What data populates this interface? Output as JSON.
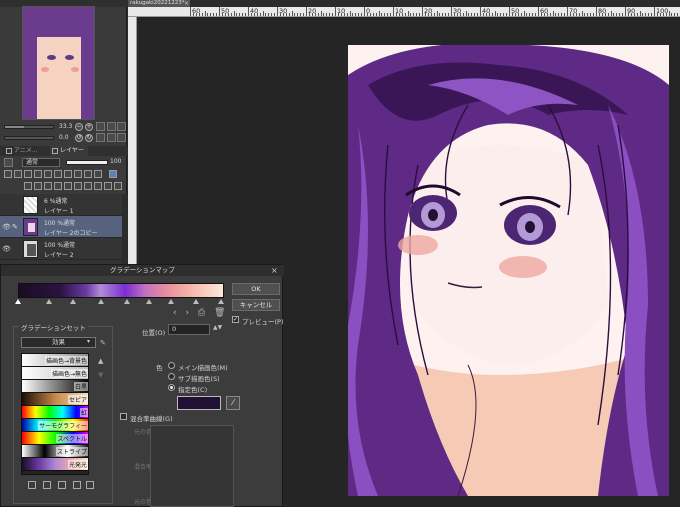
{
  "document_tab": {
    "title": "rakugaki20221223*",
    "close": "×"
  },
  "ruler": {
    "labels": [
      "60",
      "50",
      "40",
      "30",
      "20",
      "10",
      "0",
      "10",
      "20",
      "30",
      "40",
      "50",
      "60",
      "70",
      "80",
      "90",
      "100",
      "110",
      "120"
    ]
  },
  "navigator": {
    "zoom": "33.3",
    "angle": "0.0"
  },
  "panel_tabs": [
    {
      "label": "アニメ..."
    },
    {
      "label": "レイヤー"
    }
  ],
  "layer_panel": {
    "blend_mode": "通常",
    "opacity": "100"
  },
  "layers": [
    {
      "line1": "6 %通常",
      "line2": "レイヤー 1",
      "visible": false,
      "selected": false
    },
    {
      "line1": "100 %通常",
      "line2": "レイヤー 2のコピー",
      "visible": true,
      "selected": true
    },
    {
      "line1": "100 %通常",
      "line2": "レイヤー 2",
      "visible": true,
      "selected": false
    }
  ],
  "dialog": {
    "title": "グラデーションマップ",
    "close": "×",
    "ok_label": "OK",
    "cancel_label": "キャンセル",
    "preview_label": "プレビュー(P)",
    "preview_checked": true,
    "nav_glyphs": "‹ › ⎙ 🗑",
    "gradient_set": {
      "group_label": "グラデーションセット",
      "selected": "効果",
      "presets": [
        {
          "label": "描画色→背景色",
          "colors": [
            "#ffffff",
            "#888888"
          ]
        },
        {
          "label": "描画色→無色",
          "colors": [
            "#ffffff",
            "#bbbbbb"
          ]
        },
        {
          "label": "白黒",
          "colors": [
            "#ffffff",
            "#000000"
          ]
        },
        {
          "label": "セピア",
          "colors": [
            "#1c0d05",
            "#c78b4a",
            "#f7e3c2"
          ]
        },
        {
          "label": "虹",
          "colors": [
            "#ff0000",
            "#ffff00",
            "#00ff00",
            "#00ffff",
            "#0000ff",
            "#ff00ff"
          ]
        },
        {
          "label": "サーモグラフィー",
          "colors": [
            "#0000aa",
            "#00ffff",
            "#00ff00",
            "#ffff00",
            "#ff0000"
          ]
        },
        {
          "label": "スペクトル",
          "colors": [
            "#ff0000",
            "#ffff00",
            "#00ff00",
            "#0000ff",
            "#ff00ff"
          ]
        },
        {
          "label": "ストライプ",
          "colors": [
            "#ffffff",
            "#000000",
            "#ffffff",
            "#000000"
          ]
        },
        {
          "label": "光発光",
          "colors": [
            "#1a0d22",
            "#6c3aa2",
            "#b08bd8",
            "#f3b0a2",
            "#fde7dc"
          ]
        }
      ]
    },
    "position_label": "位置(O)",
    "position_value": "0",
    "color_label": "色",
    "color_options": [
      {
        "label": "メイン描画色(M)",
        "selected": false
      },
      {
        "label": "サブ描画色(S)",
        "selected": false
      },
      {
        "label": "指定色(C)",
        "selected": true
      }
    ],
    "specified_color": "#211134",
    "mix_curve_label": "混合率曲線(G)",
    "curve_axis": {
      "top": "元の色",
      "mid": "混合率",
      "bottom": "元の色"
    }
  }
}
